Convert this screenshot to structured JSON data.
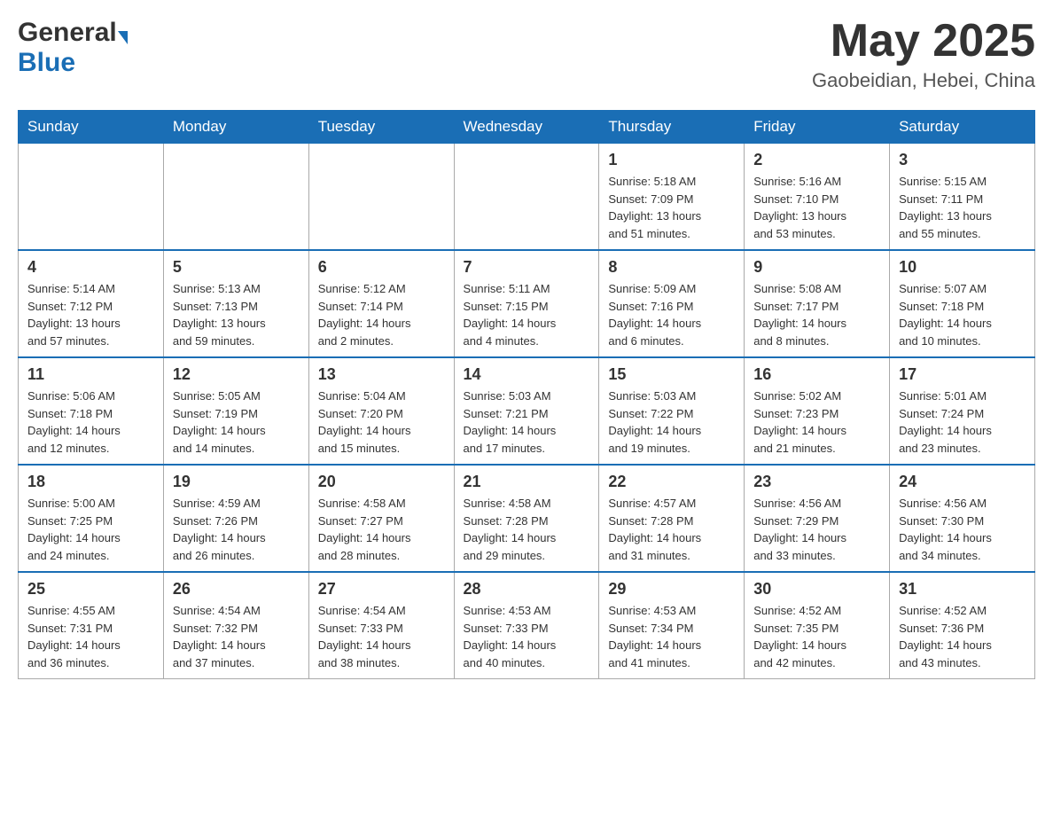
{
  "header": {
    "logo_general": "General",
    "logo_blue": "Blue",
    "month_title": "May 2025",
    "location": "Gaobeidian, Hebei, China"
  },
  "days_of_week": [
    "Sunday",
    "Monday",
    "Tuesday",
    "Wednesday",
    "Thursday",
    "Friday",
    "Saturday"
  ],
  "weeks": [
    [
      {
        "day": "",
        "info": ""
      },
      {
        "day": "",
        "info": ""
      },
      {
        "day": "",
        "info": ""
      },
      {
        "day": "",
        "info": ""
      },
      {
        "day": "1",
        "info": "Sunrise: 5:18 AM\nSunset: 7:09 PM\nDaylight: 13 hours\nand 51 minutes."
      },
      {
        "day": "2",
        "info": "Sunrise: 5:16 AM\nSunset: 7:10 PM\nDaylight: 13 hours\nand 53 minutes."
      },
      {
        "day": "3",
        "info": "Sunrise: 5:15 AM\nSunset: 7:11 PM\nDaylight: 13 hours\nand 55 minutes."
      }
    ],
    [
      {
        "day": "4",
        "info": "Sunrise: 5:14 AM\nSunset: 7:12 PM\nDaylight: 13 hours\nand 57 minutes."
      },
      {
        "day": "5",
        "info": "Sunrise: 5:13 AM\nSunset: 7:13 PM\nDaylight: 13 hours\nand 59 minutes."
      },
      {
        "day": "6",
        "info": "Sunrise: 5:12 AM\nSunset: 7:14 PM\nDaylight: 14 hours\nand 2 minutes."
      },
      {
        "day": "7",
        "info": "Sunrise: 5:11 AM\nSunset: 7:15 PM\nDaylight: 14 hours\nand 4 minutes."
      },
      {
        "day": "8",
        "info": "Sunrise: 5:09 AM\nSunset: 7:16 PM\nDaylight: 14 hours\nand 6 minutes."
      },
      {
        "day": "9",
        "info": "Sunrise: 5:08 AM\nSunset: 7:17 PM\nDaylight: 14 hours\nand 8 minutes."
      },
      {
        "day": "10",
        "info": "Sunrise: 5:07 AM\nSunset: 7:18 PM\nDaylight: 14 hours\nand 10 minutes."
      }
    ],
    [
      {
        "day": "11",
        "info": "Sunrise: 5:06 AM\nSunset: 7:18 PM\nDaylight: 14 hours\nand 12 minutes."
      },
      {
        "day": "12",
        "info": "Sunrise: 5:05 AM\nSunset: 7:19 PM\nDaylight: 14 hours\nand 14 minutes."
      },
      {
        "day": "13",
        "info": "Sunrise: 5:04 AM\nSunset: 7:20 PM\nDaylight: 14 hours\nand 15 minutes."
      },
      {
        "day": "14",
        "info": "Sunrise: 5:03 AM\nSunset: 7:21 PM\nDaylight: 14 hours\nand 17 minutes."
      },
      {
        "day": "15",
        "info": "Sunrise: 5:03 AM\nSunset: 7:22 PM\nDaylight: 14 hours\nand 19 minutes."
      },
      {
        "day": "16",
        "info": "Sunrise: 5:02 AM\nSunset: 7:23 PM\nDaylight: 14 hours\nand 21 minutes."
      },
      {
        "day": "17",
        "info": "Sunrise: 5:01 AM\nSunset: 7:24 PM\nDaylight: 14 hours\nand 23 minutes."
      }
    ],
    [
      {
        "day": "18",
        "info": "Sunrise: 5:00 AM\nSunset: 7:25 PM\nDaylight: 14 hours\nand 24 minutes."
      },
      {
        "day": "19",
        "info": "Sunrise: 4:59 AM\nSunset: 7:26 PM\nDaylight: 14 hours\nand 26 minutes."
      },
      {
        "day": "20",
        "info": "Sunrise: 4:58 AM\nSunset: 7:27 PM\nDaylight: 14 hours\nand 28 minutes."
      },
      {
        "day": "21",
        "info": "Sunrise: 4:58 AM\nSunset: 7:28 PM\nDaylight: 14 hours\nand 29 minutes."
      },
      {
        "day": "22",
        "info": "Sunrise: 4:57 AM\nSunset: 7:28 PM\nDaylight: 14 hours\nand 31 minutes."
      },
      {
        "day": "23",
        "info": "Sunrise: 4:56 AM\nSunset: 7:29 PM\nDaylight: 14 hours\nand 33 minutes."
      },
      {
        "day": "24",
        "info": "Sunrise: 4:56 AM\nSunset: 7:30 PM\nDaylight: 14 hours\nand 34 minutes."
      }
    ],
    [
      {
        "day": "25",
        "info": "Sunrise: 4:55 AM\nSunset: 7:31 PM\nDaylight: 14 hours\nand 36 minutes."
      },
      {
        "day": "26",
        "info": "Sunrise: 4:54 AM\nSunset: 7:32 PM\nDaylight: 14 hours\nand 37 minutes."
      },
      {
        "day": "27",
        "info": "Sunrise: 4:54 AM\nSunset: 7:33 PM\nDaylight: 14 hours\nand 38 minutes."
      },
      {
        "day": "28",
        "info": "Sunrise: 4:53 AM\nSunset: 7:33 PM\nDaylight: 14 hours\nand 40 minutes."
      },
      {
        "day": "29",
        "info": "Sunrise: 4:53 AM\nSunset: 7:34 PM\nDaylight: 14 hours\nand 41 minutes."
      },
      {
        "day": "30",
        "info": "Sunrise: 4:52 AM\nSunset: 7:35 PM\nDaylight: 14 hours\nand 42 minutes."
      },
      {
        "day": "31",
        "info": "Sunrise: 4:52 AM\nSunset: 7:36 PM\nDaylight: 14 hours\nand 43 minutes."
      }
    ]
  ]
}
